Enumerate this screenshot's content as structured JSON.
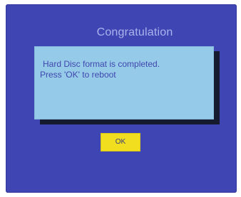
{
  "dialog": {
    "title": "Congratulation",
    "message": {
      "line1": "Hard Disc format is completed.",
      "line2": "Press 'OK' to reboot"
    },
    "buttons": {
      "ok": "OK"
    }
  },
  "colors": {
    "screen_background": "#3f46b3",
    "title_text": "#a9b4ee",
    "message_background": "#96cae9",
    "message_text": "#3f47ad",
    "shadow": "#151a2e",
    "button_background": "#f1df1f",
    "button_text": "#363b79"
  }
}
